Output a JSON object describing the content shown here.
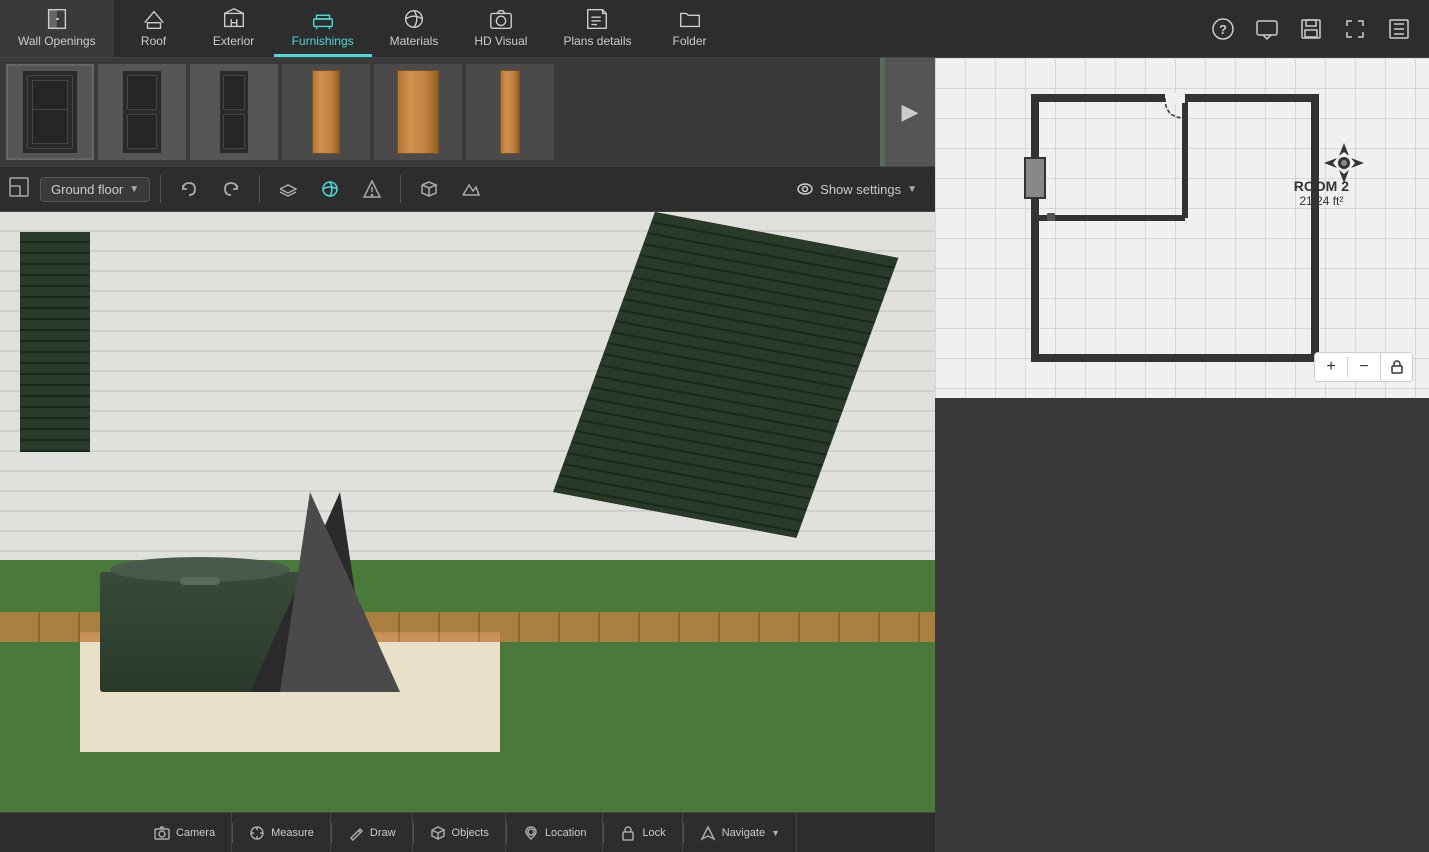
{
  "toolbar": {
    "items": [
      {
        "id": "wall-openings",
        "label": "Wall Openings",
        "icon": "door"
      },
      {
        "id": "roof",
        "label": "Roof",
        "icon": "roof"
      },
      {
        "id": "exterior",
        "label": "Exterior",
        "icon": "exterior"
      },
      {
        "id": "furnishings",
        "label": "Furnishings",
        "icon": "furnishings",
        "active": true
      },
      {
        "id": "materials",
        "label": "Materials",
        "icon": "materials"
      },
      {
        "id": "hd-visual",
        "label": "HD Visual",
        "icon": "camera"
      },
      {
        "id": "plans-details",
        "label": "Plans details",
        "icon": "plans"
      },
      {
        "id": "folder",
        "label": "Folder",
        "icon": "folder"
      }
    ]
  },
  "right_toolbar": {
    "items": [
      {
        "id": "help",
        "icon": "question-circle"
      },
      {
        "id": "comment",
        "icon": "comment"
      },
      {
        "id": "save",
        "icon": "save"
      },
      {
        "id": "fullscreen",
        "icon": "fullscreen"
      },
      {
        "id": "more",
        "icon": "more"
      }
    ]
  },
  "floor_bar": {
    "floor_label": "Ground floor",
    "show_settings_label": "Show settings",
    "undo_label": "Undo",
    "redo_label": "Redo"
  },
  "floor_plan": {
    "room_name": "ROOM 2",
    "room_size": "21.24 ft²",
    "zoom_in_label": "+",
    "zoom_out_label": "−"
  },
  "bottom_toolbar": {
    "items": [
      {
        "id": "camera",
        "label": "Camera"
      },
      {
        "id": "measure",
        "label": "Measure"
      },
      {
        "id": "draw",
        "label": "Draw"
      },
      {
        "id": "objects",
        "label": "Objects"
      },
      {
        "id": "location",
        "label": "Location"
      },
      {
        "id": "lock",
        "label": "Lock"
      },
      {
        "id": "navigate",
        "label": "Navigate"
      }
    ]
  },
  "thumbnails": [
    {
      "id": "thumb1",
      "type": "dark-door"
    },
    {
      "id": "thumb2",
      "type": "dark-door-narrow"
    },
    {
      "id": "thumb3",
      "type": "dark-door-2"
    },
    {
      "id": "thumb4",
      "type": "wood-pillar-narrow"
    },
    {
      "id": "thumb5",
      "type": "wood-pillar-wide"
    },
    {
      "id": "thumb6",
      "type": "wood-pillar-thin"
    }
  ],
  "colors": {
    "accent": "#4dd9d9",
    "toolbar_bg": "#2d2d2d",
    "panel_bg": "#3a3a3a",
    "active_tab_color": "#4dd9d9"
  }
}
